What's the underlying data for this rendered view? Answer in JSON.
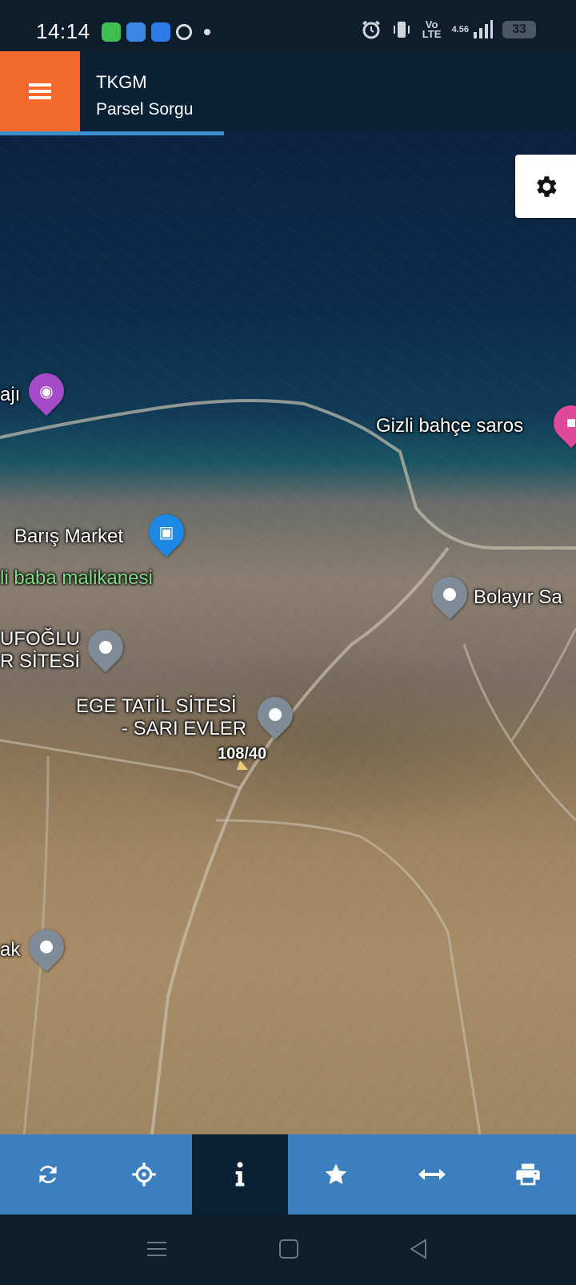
{
  "status_bar": {
    "time": "14:14",
    "network": "Vo LTE",
    "speed": "4.56",
    "battery": "33",
    "notification_icons": [
      "messages-icon",
      "weather-icon",
      "files-icon",
      "chrome-icon",
      "more-dot-icon"
    ],
    "system_icons": [
      "alarm-icon",
      "vibrate-icon",
      "volte-icon",
      "signal-icon",
      "battery-icon"
    ]
  },
  "header": {
    "title": "TKGM",
    "subtitle": "Parsel Sorgu",
    "accent": "#f46a2a"
  },
  "map": {
    "labels": {
      "poi_1": "ajı",
      "poi_2": "Gizli bahçe saros",
      "poi_3": "Barış Market",
      "poi_4": "li baba malikanesi",
      "poi_5_line1": "UFOĞLU",
      "poi_5_line2": "R SİTESİ",
      "poi_6_line1": "EGE TATİL SİTESİ",
      "poi_6_line2": "- SARI EVLER",
      "poi_7": "Bolayır Sa",
      "poi_8": "ak",
      "parcel": "108/40"
    }
  },
  "toolbar": {
    "items": [
      {
        "name": "refresh",
        "icon": "refresh-icon"
      },
      {
        "name": "locate",
        "icon": "crosshair-icon"
      },
      {
        "name": "info",
        "icon": "info-icon",
        "active": true
      },
      {
        "name": "favorites",
        "icon": "star-icon"
      },
      {
        "name": "measure",
        "icon": "arrows-horizontal-icon"
      },
      {
        "name": "print",
        "icon": "print-icon"
      }
    ],
    "color": "#3b7fc0",
    "active_color": "#0b2135"
  }
}
